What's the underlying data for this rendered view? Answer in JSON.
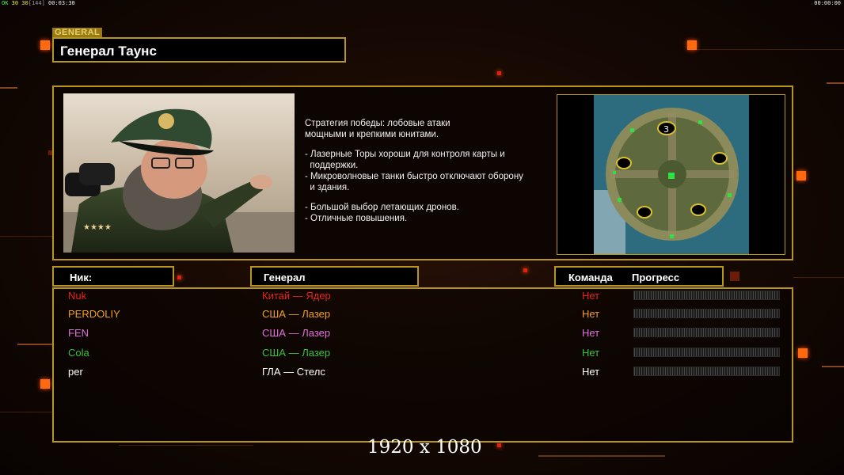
{
  "hud": {
    "left_ok": "OK",
    "left_fps": "30 30",
    "left_mid": "[144]",
    "left_time": "00:03:30",
    "right_time": "00:00:00"
  },
  "general_tag": "GENERAL",
  "general_name": "Генерал Таунс",
  "description": {
    "line1": "Стратегия победы: лобовые атаки",
    "line2": "мощными и крепкими юнитами.",
    "line3": "- Лазерные Торы хороши для контроля карты и",
    "line4": "  поддержки.",
    "line5": "- Микроволновые танки быстро отключают оборону",
    "line6": "  и здания.",
    "line7": "- Большой выбор летающих дронов.",
    "line8": "- Отличные повышения."
  },
  "map": {
    "player_count_label": "3"
  },
  "headers": {
    "nick": "Ник:",
    "general": "Генерал",
    "team": "Команда",
    "progress": "Прогресс"
  },
  "players": [
    {
      "nick": "Nuk",
      "general": "Китай — Ядер",
      "team": "Нет",
      "color": "#e8231a",
      "progress": 0
    },
    {
      "nick": "PERDOLIY",
      "general": "США — Лазер",
      "team": "Нет",
      "color": "#f0a020",
      "progress": 0
    },
    {
      "nick": "FEN",
      "general": "США — Лазер",
      "team": "Нет",
      "color": "#e070e0",
      "progress": 0
    },
    {
      "nick": "Cola",
      "general": "США — Лазер",
      "team": "Нет",
      "color": "#3ac23a",
      "progress": 0
    },
    {
      "nick": "per",
      "general": "ГЛА — Стелс",
      "team": "Нет",
      "color": "#ffffff",
      "progress": 0
    }
  ],
  "resolution_caption": "1920 x 1080"
}
